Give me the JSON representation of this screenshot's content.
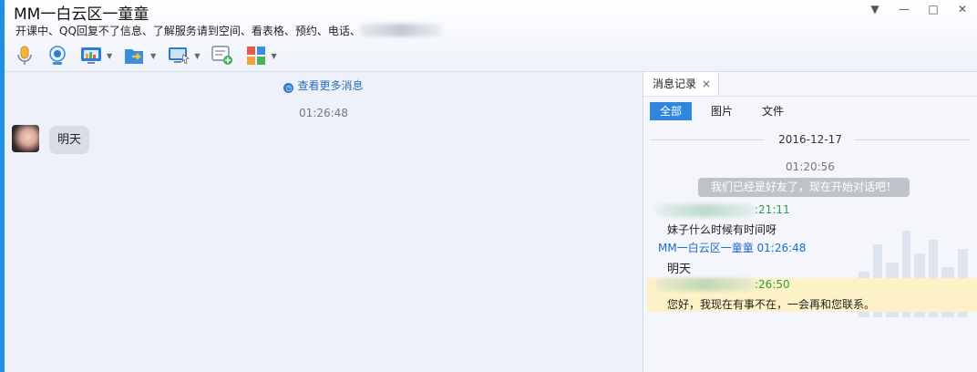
{
  "window": {
    "title": "MM一白云区一童童",
    "subtitle": "开课中、QQ回复不了信息、了解服务请到空间、看表格、预约、电话、"
  },
  "toolbar": {
    "buttons": [
      {
        "icon": "microphone-icon"
      },
      {
        "icon": "webcam-icon"
      },
      {
        "icon": "app-share-icon"
      },
      {
        "icon": "file-transfer-icon"
      },
      {
        "icon": "remote-desktop-icon"
      },
      {
        "icon": "new-chat-icon"
      },
      {
        "icon": "apps-grid-icon"
      }
    ]
  },
  "chat": {
    "more_messages": "查看更多消息",
    "time": "01:26:48",
    "message_text": "明天"
  },
  "history": {
    "tab_label": "消息记录",
    "tab_close": "×",
    "filters": [
      "全部",
      "图片",
      "文件"
    ],
    "date": "2016-12-17",
    "time": "01:20:56",
    "system_msg": "我们已经是好友了，现在开始对话吧！",
    "msg1_time": ":21:11",
    "msg1_text": "妹子什么时候有时间呀",
    "msg2_header": "MM一白云区一童童 01:26:48",
    "msg2_text": "明天",
    "msg3_time": ":26:50",
    "msg3_text": "您好，我现在有事不在，一会再和您联系。"
  },
  "colors": {
    "accent": "#2e87dd",
    "side_strip": "#1f8fe3",
    "sender_green": "#2aa04a",
    "self_blue": "#1f6cc4",
    "auto_reply_bg": "#fdf1c8"
  }
}
